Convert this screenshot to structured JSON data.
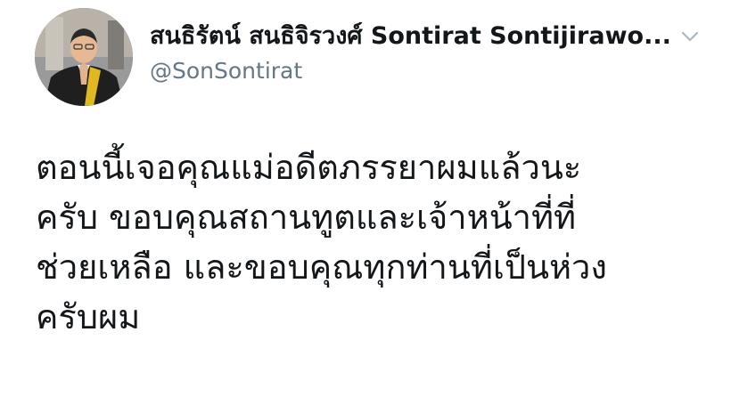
{
  "author": {
    "display_name": "สนธิรัตน์ สนธิจิรวงศ์ Sontirat Sontijirawo...",
    "handle": "@SonSontirat",
    "avatar_icon": "profile-photo"
  },
  "menu": {
    "icon": "chevron-down-icon"
  },
  "tweet": {
    "lines": [
      "ตอนนี้เจอคุณแม่อดีตภรรยาผมแล้วนะ",
      "ครับ ขอบคุณสถานทูตและเจ้าหน้าที่ที่",
      "ช่วยเหลือ และขอบคุณทุกท่านที่เป็นห่วง",
      "ครับผม"
    ]
  },
  "colors": {
    "name": "#14171a",
    "handle": "#657786",
    "text": "#14171a",
    "chevron": "#aab8c2"
  }
}
